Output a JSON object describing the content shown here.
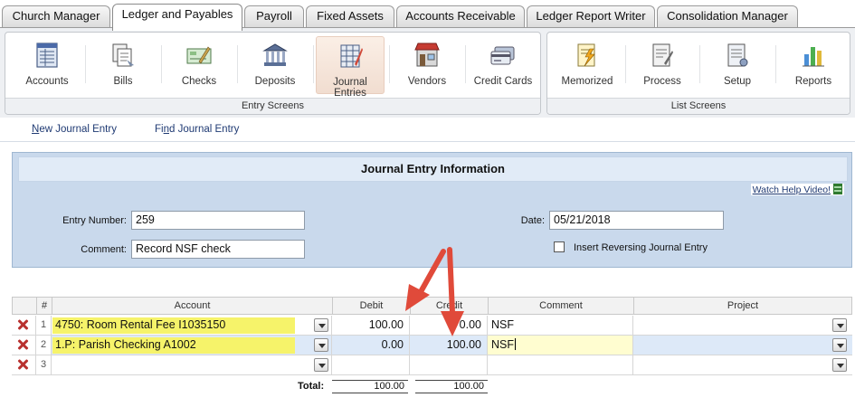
{
  "tabs": [
    "Church Manager",
    "Ledger and Payables",
    "Payroll",
    "Fixed Assets",
    "Accounts Receivable",
    "Ledger Report Writer",
    "Consolidation Manager"
  ],
  "active_tab": "Ledger and Payables",
  "ribbon": {
    "entry_screens": {
      "label": "Entry Screens",
      "buttons": [
        "Accounts",
        "Bills",
        "Checks",
        "Deposits",
        "Journal Entries",
        "Vendors",
        "Credit Cards"
      ]
    },
    "list_screens": {
      "label": "List Screens",
      "buttons": [
        "Memorized",
        "Process",
        "Setup",
        "Reports"
      ]
    },
    "active_button": "Journal Entries"
  },
  "sublinks": {
    "new_prefix": "N",
    "new_rest": "ew Journal Entry",
    "find_prefix": "Fi",
    "find_underline": "n",
    "find_rest": "d Journal Entry"
  },
  "form": {
    "title": "Journal Entry Information",
    "help_link": "Watch Help Video!",
    "entry_number_label": "Entry Number:",
    "entry_number": "259",
    "comment_label": "Comment:",
    "comment": "Record NSF check",
    "date_label": "Date:",
    "date": "05/21/2018",
    "reversing_label": "Insert Reversing Journal Entry",
    "reversing_checked": false
  },
  "grid": {
    "headers": [
      "#",
      "Account",
      "Debit",
      "Credit",
      "Comment",
      "Project"
    ],
    "rows": [
      {
        "n": "1",
        "account": "4750: Room Rental Fee I1035150",
        "debit": "100.00",
        "credit": "0.00",
        "comment": "NSF",
        "project": ""
      },
      {
        "n": "2",
        "account": "1.P: Parish Checking A1002",
        "debit": "0.00",
        "credit": "100.00",
        "comment": "NSF",
        "project": ""
      },
      {
        "n": "3",
        "account": "",
        "debit": "",
        "credit": "",
        "comment": "",
        "project": ""
      }
    ],
    "totals_label": "Total:",
    "total_debit": "100.00",
    "total_credit": "100.00"
  },
  "colors": {
    "highlight": "#f6f36a",
    "selected_row": "#dde9f8",
    "arrow": "#e04a3a",
    "panel": "#c9d9ec"
  }
}
